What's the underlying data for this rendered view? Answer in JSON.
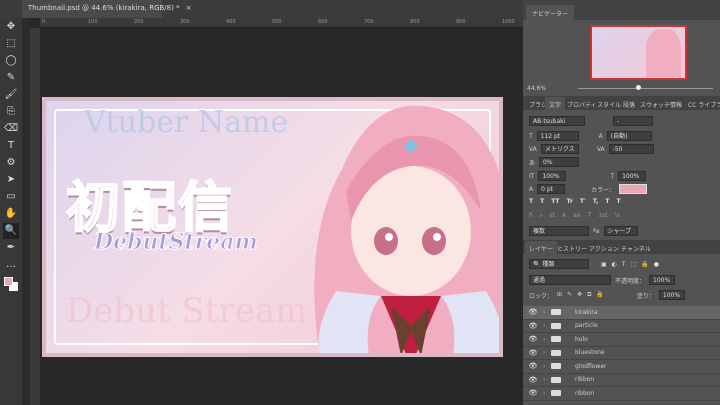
{
  "document": {
    "tab_title": "Thumbnail.psd @ 44.6% (kirakira, RGB/8) *",
    "close": "×"
  },
  "ruler": [
    "0",
    "100",
    "200",
    "300",
    "400",
    "500",
    "600",
    "700",
    "800",
    "900",
    "1000"
  ],
  "tools": [
    "✥",
    "⬚",
    "◯",
    "✎",
    "🖌",
    "⎘",
    "⌫",
    "T",
    "⚙",
    "➤",
    "▭",
    "✋",
    "🔍",
    "✒",
    "…"
  ],
  "canvas": {
    "vtuber_name": "Vtuber Name",
    "title": "初配信",
    "subtitle": "DebutStream",
    "bg_text": "Debut Stream"
  },
  "navigator": {
    "tab": "ナビゲーター",
    "zoom": "44.6%"
  },
  "panel_tabs": [
    "ブラシ",
    "文字",
    "プロパティ",
    "スタイル",
    "段落",
    "スウォッチ",
    "情報",
    "CC ライブラ"
  ],
  "character": {
    "font": "AB-tsubaki",
    "style": "-",
    "size": "112 pt",
    "leading": "(自動)",
    "kerning": "メトリクス",
    "tracking": "-50",
    "vscale_pct": "0%",
    "vert": "100%",
    "horiz": "100%",
    "baseline": "0 pt",
    "color_label": "カラー：",
    "color": "#e8a7b4",
    "lang": "複数",
    "aa": "シャープ",
    "aa_icon": "ªa",
    "styles": [
      "T",
      "T",
      "TT",
      "Tr",
      "T'",
      "T,",
      "T",
      "T"
    ],
    "ot": [
      "fi",
      "ℴ",
      "st",
      "A",
      "aa",
      "T",
      "1st",
      "½"
    ]
  },
  "layers_tabs": [
    "レイヤー",
    "ヒストリー",
    "アクション",
    "チャンネル"
  ],
  "layers": {
    "filter": "種類",
    "blend": "通過",
    "opacity_label": "不透明度：",
    "opacity": "100%",
    "lock_label": "ロック：",
    "fill_label": "塗り：",
    "fill": "100%",
    "items": [
      "kirakira",
      "particle",
      "holo",
      "bluestone",
      "glodflower",
      "ribbon",
      "ribbon"
    ]
  }
}
